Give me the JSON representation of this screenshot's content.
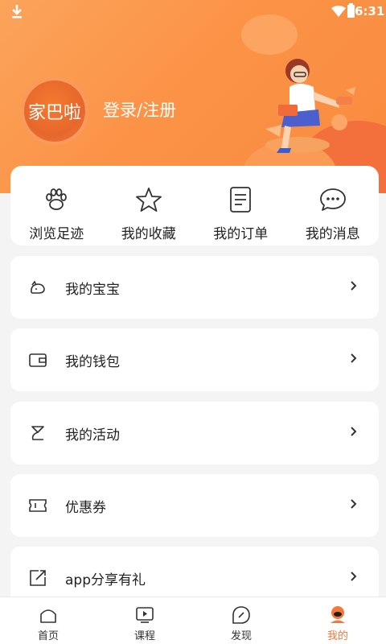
{
  "status_bar": {
    "time": "6:31"
  },
  "profile": {
    "avatar_text": "家巴啦",
    "login_label": "登录/注册"
  },
  "quick_actions": [
    {
      "label": "浏览足迹",
      "icon": "paw-icon"
    },
    {
      "label": "我的收藏",
      "icon": "star-icon"
    },
    {
      "label": "我的订单",
      "icon": "order-list-icon"
    },
    {
      "label": "我的消息",
      "icon": "message-icon"
    }
  ],
  "menu": [
    {
      "label": "我的宝宝",
      "icon": "baby-icon"
    },
    {
      "label": "我的钱包",
      "icon": "wallet-icon"
    },
    {
      "label": "我的活动",
      "icon": "activity-icon"
    },
    {
      "label": "优惠券",
      "icon": "coupon-icon"
    },
    {
      "label": "app分享有礼",
      "icon": "share-icon"
    }
  ],
  "tabs": [
    {
      "label": "首页",
      "icon": "home-icon",
      "active": false
    },
    {
      "label": "课程",
      "icon": "course-icon",
      "active": false
    },
    {
      "label": "发现",
      "icon": "discover-icon",
      "active": false
    },
    {
      "label": "我的",
      "icon": "profile-icon",
      "active": true
    }
  ],
  "colors": {
    "header": "#fb9347",
    "accent": "#f5773a",
    "background": "#f4f4f4"
  }
}
